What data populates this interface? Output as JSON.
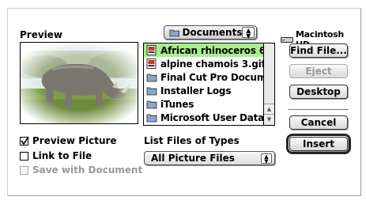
{
  "preview": {
    "label": "Preview"
  },
  "location": {
    "label": "Documents",
    "icon": "folder-icon"
  },
  "disk": {
    "label": "Macintosh HD",
    "icon": "hard-disk-icon"
  },
  "files": [
    {
      "name": "African rhinoceros 6.gif",
      "icon": "gif-file-icon",
      "selected": true
    },
    {
      "name": "alpine chamois 3.gif",
      "icon": "gif-file-icon",
      "selected": false
    },
    {
      "name": "Final Cut Pro Documents",
      "icon": "folder-icon",
      "selected": false
    },
    {
      "name": "Installer Logs",
      "icon": "folder-icon",
      "selected": false
    },
    {
      "name": "iTunes",
      "icon": "folder-icon",
      "selected": false
    },
    {
      "name": "Microsoft User Data",
      "icon": "folder-icon",
      "selected": false
    }
  ],
  "buttons": {
    "find_file": "Find File...",
    "eject": "Eject",
    "desktop": "Desktop",
    "cancel": "Cancel",
    "insert": "Insert"
  },
  "options": {
    "preview_picture": {
      "label": "Preview Picture",
      "checked": true
    },
    "link_to_file": {
      "label": "Link to File",
      "checked": false
    },
    "save_with_document": {
      "label": "Save with Document",
      "checked": false,
      "disabled": true
    }
  },
  "file_types": {
    "label": "List Files of Types",
    "value": "All Picture Files"
  },
  "colors": {
    "selection": "#a6ef8e"
  }
}
